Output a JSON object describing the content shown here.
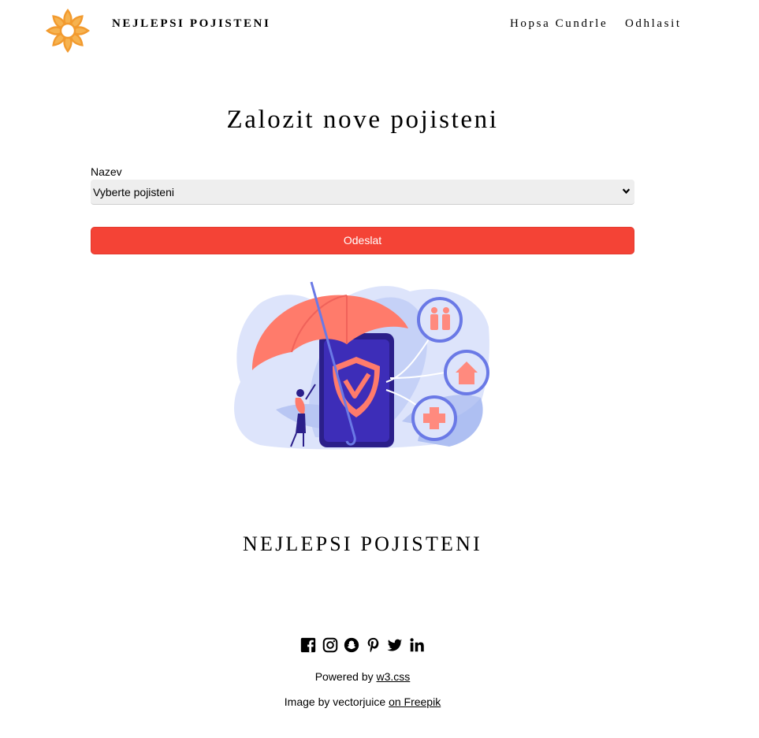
{
  "header": {
    "brand": "NEJLEPSI POJISTENI",
    "user_link": "Hopsa Cundrle",
    "logout_link": "Odhlasit",
    "logo_color": "#f29a2e"
  },
  "main": {
    "title": "Zalozit nove pojisteni",
    "field_label": "Nazev",
    "select_value": "Vyberte pojisteni",
    "submit_label": "Odeslat",
    "accent_color": "#f44336"
  },
  "footer": {
    "brand": "NEJLEPSI POJISTENI",
    "social_icons": [
      "facebook-icon",
      "instagram-icon",
      "snapchat-icon",
      "pinterest-icon",
      "twitter-icon",
      "linkedin-icon"
    ],
    "powered_prefix": "Powered by",
    "powered_link": "w3.css",
    "credit_prefix": "Image by vectorjuice",
    "credit_link": "on Freepik"
  }
}
